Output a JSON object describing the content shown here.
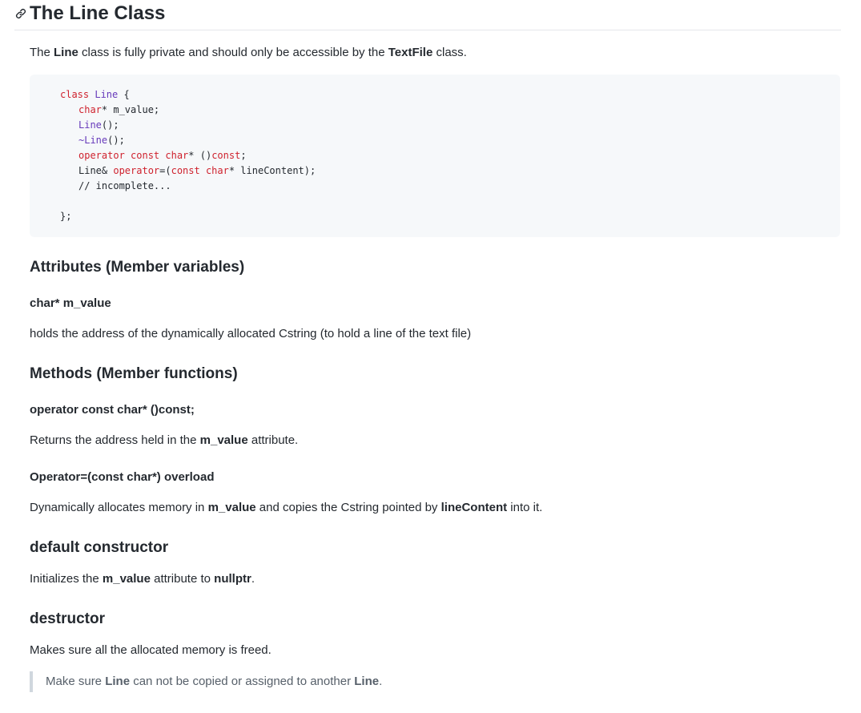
{
  "header": {
    "title": "The Line Class",
    "link_icon": "link-icon"
  },
  "intro": {
    "t1": "The ",
    "b1": "Line",
    "t2": " class is fully private and should only be accessible by the ",
    "b2": "TextFile",
    "t3": " class."
  },
  "code": {
    "l1a": "class",
    "l1b": " Line",
    "l1c": " {",
    "l2a": "char",
    "l2b": "* m_value;",
    "l3a": "Line",
    "l3b": "();",
    "l4a": "~Line",
    "l4b": "();",
    "l5a": "operator const char",
    "l5b": "* ()",
    "l5c": "const",
    "l5d": ";",
    "l6a": "Line& ",
    "l6b": "operator",
    "l6c": "=(",
    "l6d": "const char",
    "l6e": "* lineContent);",
    "l7": "// incomplete...",
    "l8": "};"
  },
  "sections": {
    "attributes_heading": "Attributes (Member variables)",
    "m_value_heading": "char* m_value",
    "m_value_desc": "holds the address of the dynamically allocated Cstring (to hold a line of the text file)",
    "methods_heading": "Methods (Member functions)",
    "op_const_heading": "operator const char* ()const;",
    "op_const_desc": {
      "t1": "Returns the address held in the ",
      "b1": "m_value",
      "t2": " attribute."
    },
    "op_assign_heading": "Operator=(const char*) overload",
    "op_assign_desc": {
      "t1": "Dynamically allocates memory in ",
      "b1": "m_value",
      "t2": " and copies the Cstring pointed by ",
      "b2": "lineContent",
      "t3": " into it."
    },
    "ctor_heading": "default constructor",
    "ctor_desc": {
      "t1": "Initializes the ",
      "b1": "m_value",
      "t2": " attribute to ",
      "b2": "nullptr",
      "t3": "."
    },
    "dtor_heading": "destructor",
    "dtor_desc": "Makes sure all the allocated memory is freed.",
    "note": {
      "t1": "Make sure ",
      "b1": "Line",
      "t2": " can not be copied or assigned to another ",
      "b2": "Line",
      "t3": "."
    }
  }
}
